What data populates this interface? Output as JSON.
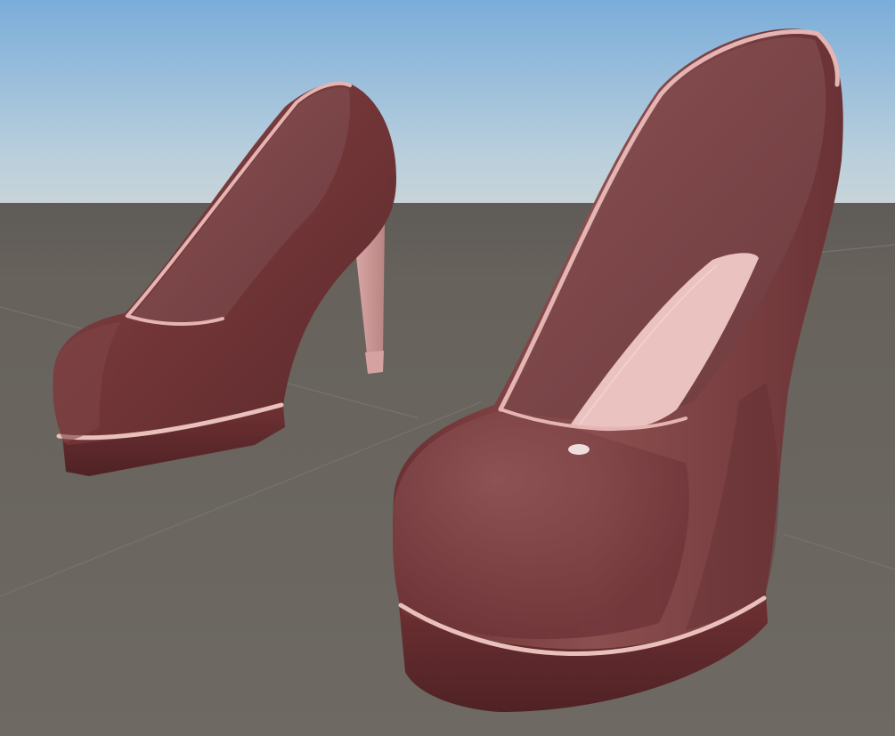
{
  "scene": {
    "sky_top_color": "#7fb0dc",
    "sky_horizon_color": "#c7d6dd",
    "ground_color": "#68635d",
    "grid_line_color": "#7a7670",
    "shoe_leather_color": "#7a3a3c",
    "shoe_leather_shadow": "#4e2427",
    "shoe_trim_color": "#e6b8b4",
    "insole_color": "#ecc6c4"
  }
}
